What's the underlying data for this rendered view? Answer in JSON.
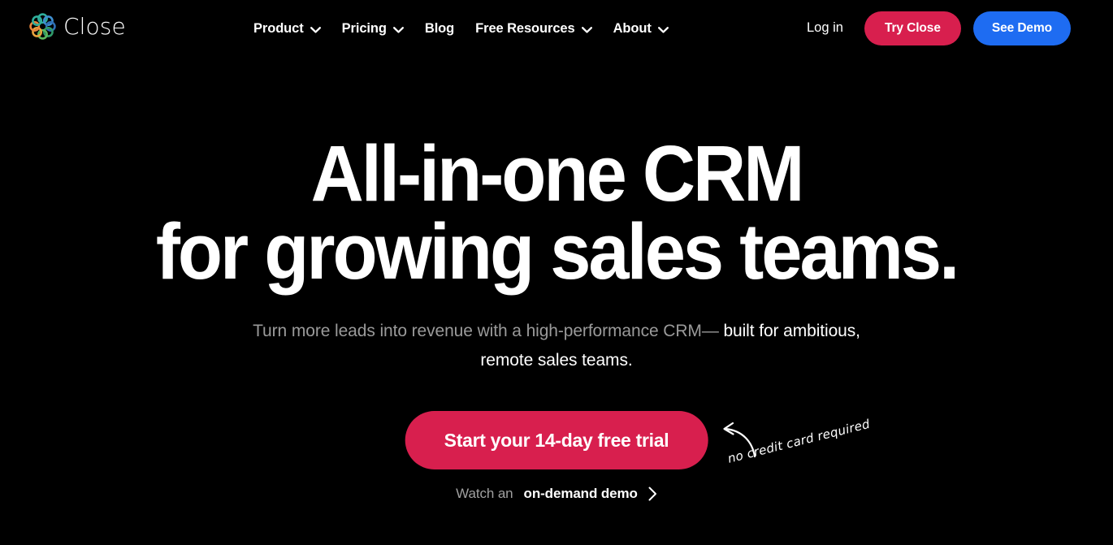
{
  "theme": {
    "background": "#000000",
    "text_primary": "#ffffff",
    "text_muted": "#9a9a9a",
    "accent_red": "#d81f4e",
    "accent_blue": "#1e6cf2"
  },
  "header": {
    "brand": {
      "name": "Close",
      "logo_icon": "close-ring-logo-icon"
    },
    "nav": [
      {
        "label": "Product",
        "has_dropdown": true,
        "icon": "chevron-down-icon"
      },
      {
        "label": "Pricing",
        "has_dropdown": true,
        "icon": "chevron-down-icon"
      },
      {
        "label": "Blog",
        "has_dropdown": false,
        "icon": ""
      },
      {
        "label": "Free Resources",
        "has_dropdown": true,
        "icon": "chevron-down-icon"
      },
      {
        "label": "About",
        "has_dropdown": true,
        "icon": "chevron-down-icon"
      }
    ],
    "actions": {
      "login_label": "Log in",
      "try_label": "Try Close",
      "demo_label": "See Demo"
    }
  },
  "hero": {
    "title_line1": "All-in-one CRM",
    "title_line2": "for growing sales teams.",
    "subheading_muted": "Turn more leads into revenue with a high-performance CRM— ",
    "subheading_strong": "built for ambitious, remote sales teams.",
    "cta_primary_label": "Start your 14-day free trial",
    "annotation_text": "no credit card required",
    "annotation_arrow_icon": "curved-arrow-left-icon",
    "secondary_link_prefix": "Watch an ",
    "secondary_link_strong": "on-demand demo",
    "secondary_link_icon": "chevron-right-icon"
  }
}
